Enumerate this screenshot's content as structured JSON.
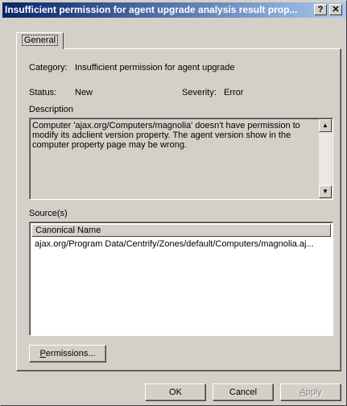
{
  "window": {
    "title": "Insufficient permission for agent upgrade analysis result prop...",
    "help_button": "?",
    "close_button": "✕"
  },
  "tabs": [
    {
      "label": "General"
    }
  ],
  "general": {
    "category_label": "Category:",
    "category_value": "Insufficient permission for agent upgrade",
    "status_label": "Status:",
    "status_value": "New",
    "severity_label": "Severity:",
    "severity_value": "Error",
    "description_label": "Description",
    "description_text": "Computer 'ajax.org/Computers/magnolia' doesn't have permission to modify its adclient version property. The agent version show in the computer property page may be wrong.",
    "sources_label": "Source(s)",
    "sources_column": "Canonical Name",
    "sources_rows": [
      "ajax.org/Program Data/Centrify/Zones/default/Computers/magnolia.aj..."
    ],
    "permissions_button_first": "P",
    "permissions_button_rest": "ermissions..."
  },
  "footer": {
    "ok_label": "OK",
    "cancel_label": "Cancel",
    "apply_first": "A",
    "apply_rest": "pply"
  }
}
